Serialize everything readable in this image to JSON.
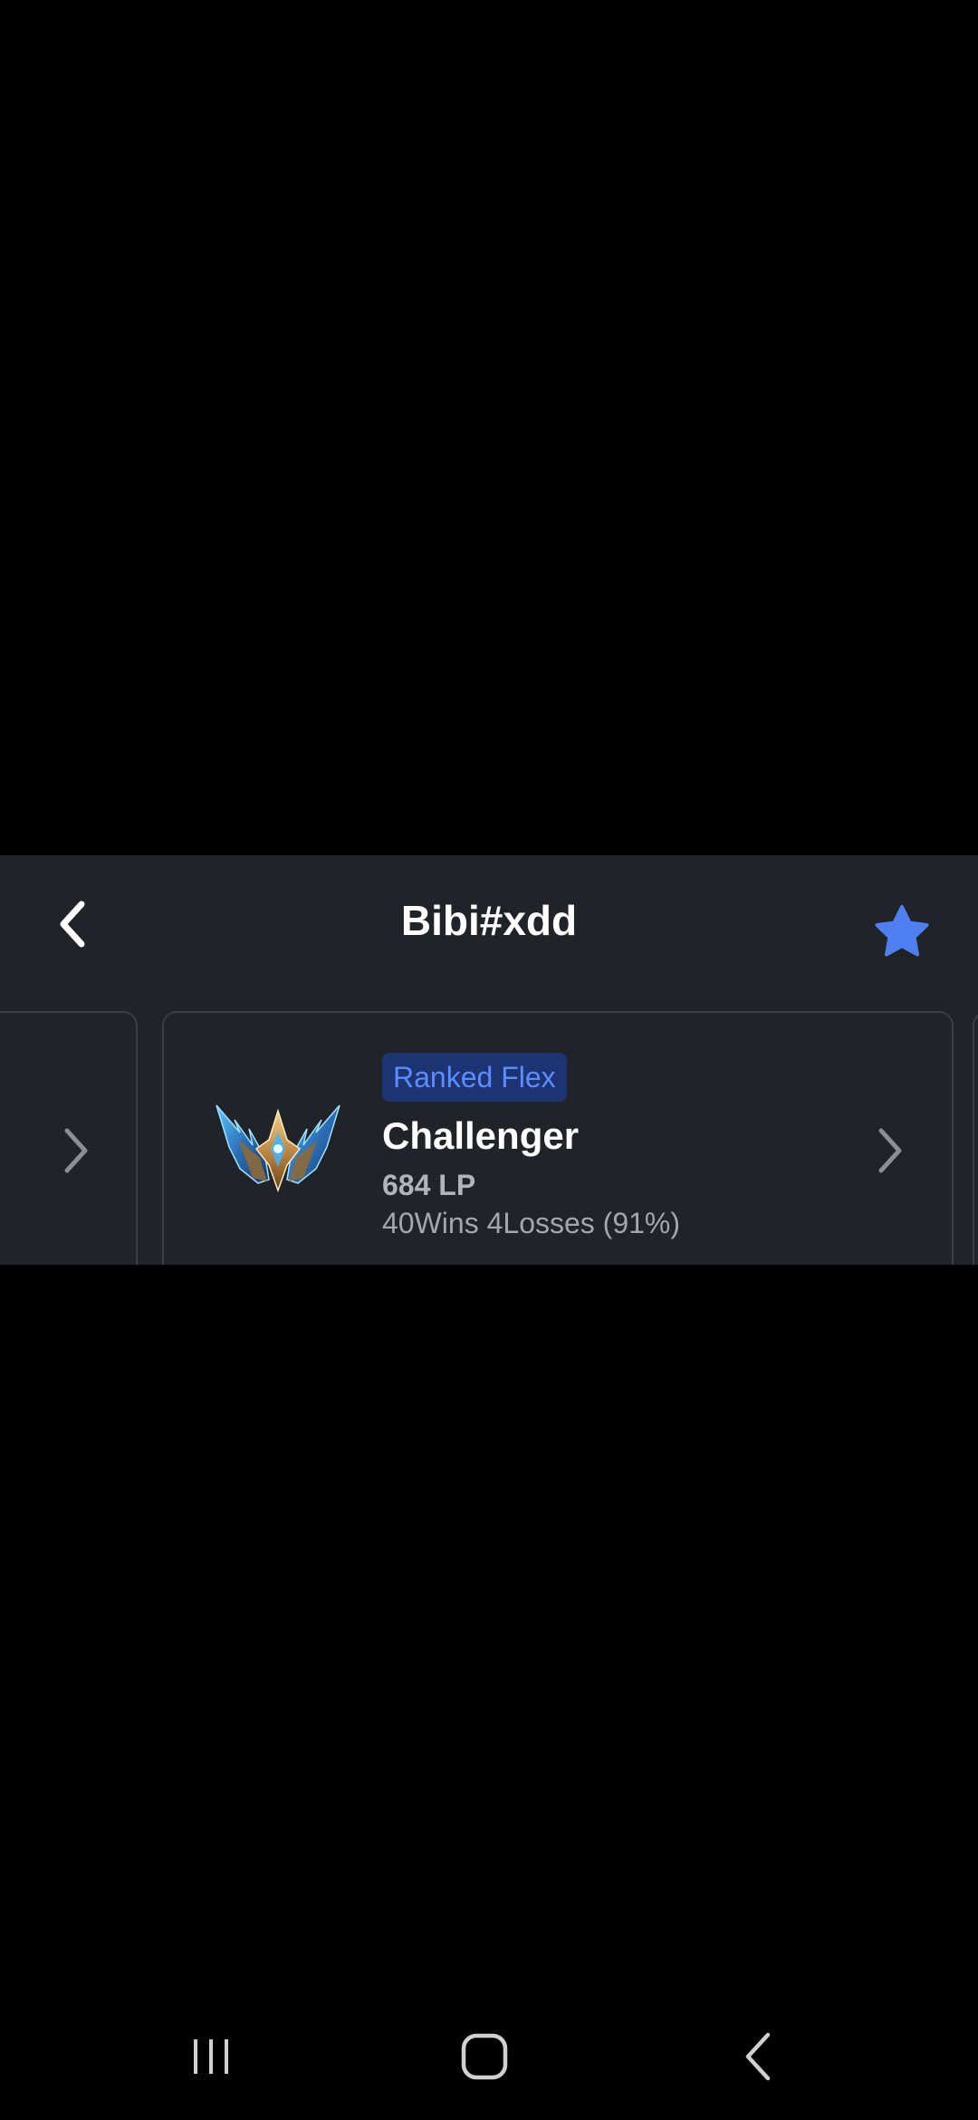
{
  "header": {
    "title": "Bibi#xdd",
    "accent_color": "#4f7ff0",
    "back_icon": "chevron-left-icon",
    "favorite_icon": "star-icon"
  },
  "rank_card": {
    "queue_label": "Ranked Flex",
    "tier": "Challenger",
    "lp": "684 LP",
    "record": "40Wins 4Losses (91%)",
    "emblem_icon": "challenger-emblem-icon",
    "detail_icon": "chevron-right-icon"
  },
  "nav_bar": {
    "recents_icon": "recents-icon",
    "home_icon": "home-icon",
    "back_icon": "back-icon"
  },
  "colors": {
    "panel_bg": "#202328",
    "badge_bg": "#1e3372",
    "badge_text": "#5a8dff",
    "card_border": "#3a3e45"
  }
}
